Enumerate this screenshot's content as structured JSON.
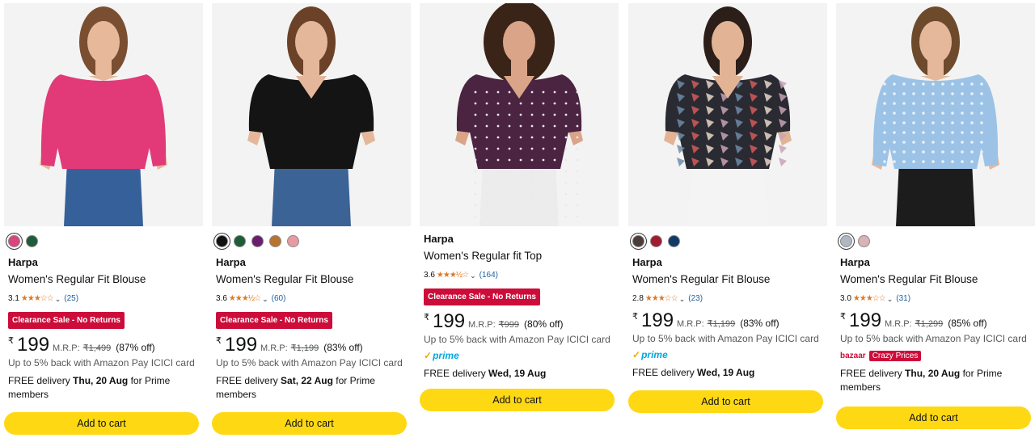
{
  "products": [
    {
      "brand": "Harpa",
      "title": "Women's Regular Fit Blouse",
      "rating": "3.1",
      "review_count": "(25)",
      "stars": "★★★☆☆",
      "badge": "Clearance Sale - No Returns",
      "currency": "₹",
      "price": "199",
      "mrp_label": "M.R.P:",
      "mrp": "₹1,499",
      "discount": "(87% off)",
      "cashback": "Up to 5% back with Amazon Pay ICICI card",
      "delivery_prefix": "FREE delivery ",
      "delivery_date": "Thu, 20 Aug",
      "delivery_suffix": " for Prime members",
      "cart_label": "Add to cart",
      "swatches": [
        "#d9457c",
        "#1f5c3a"
      ],
      "image": {
        "bg": "#f3f3f3",
        "garment": "#e23a78",
        "pants": "#35609a",
        "skin": "#e7b89a",
        "hair": "#7a4f31"
      }
    },
    {
      "brand": "Harpa",
      "title": "Women's Regular Fit Blouse",
      "rating": "3.6",
      "review_count": "(60)",
      "stars": "★★★½☆",
      "badge": "Clearance Sale - No Returns",
      "currency": "₹",
      "price": "199",
      "mrp_label": "M.R.P:",
      "mrp": "₹1,199",
      "discount": "(83% off)",
      "cashback": "Up to 5% back with Amazon Pay ICICI card",
      "delivery_prefix": "FREE delivery ",
      "delivery_date": "Sat, 22 Aug",
      "delivery_suffix": " for Prime members",
      "cart_label": "Add to cart",
      "swatches": [
        "#111111",
        "#1f5c3a",
        "#6a1f6e",
        "#b8742f",
        "#e89aa2"
      ],
      "image": {
        "bg": "#f3f3f3",
        "garment": "#141414",
        "pants": "#3c6396",
        "skin": "#e4b79b",
        "hair": "#6b4128"
      }
    },
    {
      "brand": "Harpa",
      "title": "Women's Regular fit Top",
      "rating": "3.6",
      "review_count": "(164)",
      "stars": "★★★½☆",
      "badge": "Clearance Sale - No Returns",
      "currency": "₹",
      "price": "199",
      "mrp_label": "M.R.P:",
      "mrp": "₹999",
      "discount": "(80% off)",
      "cashback": "Up to 5% back with Amazon Pay ICICI card",
      "prime_label": "prime",
      "delivery_prefix": "FREE delivery ",
      "delivery_date": "Wed, 19 Aug",
      "delivery_suffix": "",
      "cart_label": "Add to cart",
      "swatches": [],
      "image": {
        "bg": "#f3f3f3",
        "garment": "#4a2440",
        "pants": "#ececec",
        "skin": "#d9a488",
        "hair": "#3a2418"
      }
    },
    {
      "brand": "Harpa",
      "title": "Women's Regular Fit Blouse",
      "rating": "2.8",
      "review_count": "(23)",
      "stars": "★★★☆☆",
      "badge": "",
      "currency": "₹",
      "price": "199",
      "mrp_label": "M.R.P:",
      "mrp": "₹1,199",
      "discount": "(83% off)",
      "cashback": "Up to 5% back with Amazon Pay ICICI card",
      "prime_label": "prime",
      "delivery_prefix": "FREE delivery ",
      "delivery_date": "Wed, 19 Aug",
      "delivery_suffix": "",
      "cart_label": "Add to cart",
      "swatches": [
        "#4a3d3a",
        "#a01c2e",
        "#123a66"
      ],
      "image": {
        "bg": "#f3f3f3",
        "garment": "#2a2a32",
        "pants": "#f4f4f4",
        "skin": "#e2b495",
        "hair": "#2c1e18"
      }
    },
    {
      "brand": "Harpa",
      "title": "Women's Regular Fit Blouse",
      "rating": "3.0",
      "review_count": "(31)",
      "stars": "★★★☆☆",
      "badge": "",
      "currency": "₹",
      "price": "199",
      "mrp_label": "M.R.P:",
      "mrp": "₹1,299",
      "discount": "(85% off)",
      "cashback": "Up to 5% back with Amazon Pay ICICI card",
      "bazaar_logo": "bazaar",
      "bazaar_tag": "Crazy Prices",
      "delivery_prefix": "FREE delivery ",
      "delivery_date": "Thu, 20 Aug",
      "delivery_suffix": " for Prime members",
      "cart_label": "Add to cart",
      "swatches": [
        "#aeb7c2",
        "#d9b3b8"
      ],
      "image": {
        "bg": "#f3f3f3",
        "garment": "#9cc3e6",
        "pants": "#1c1c1c",
        "skin": "#e6b89b",
        "hair": "#6e4a2c"
      }
    }
  ]
}
